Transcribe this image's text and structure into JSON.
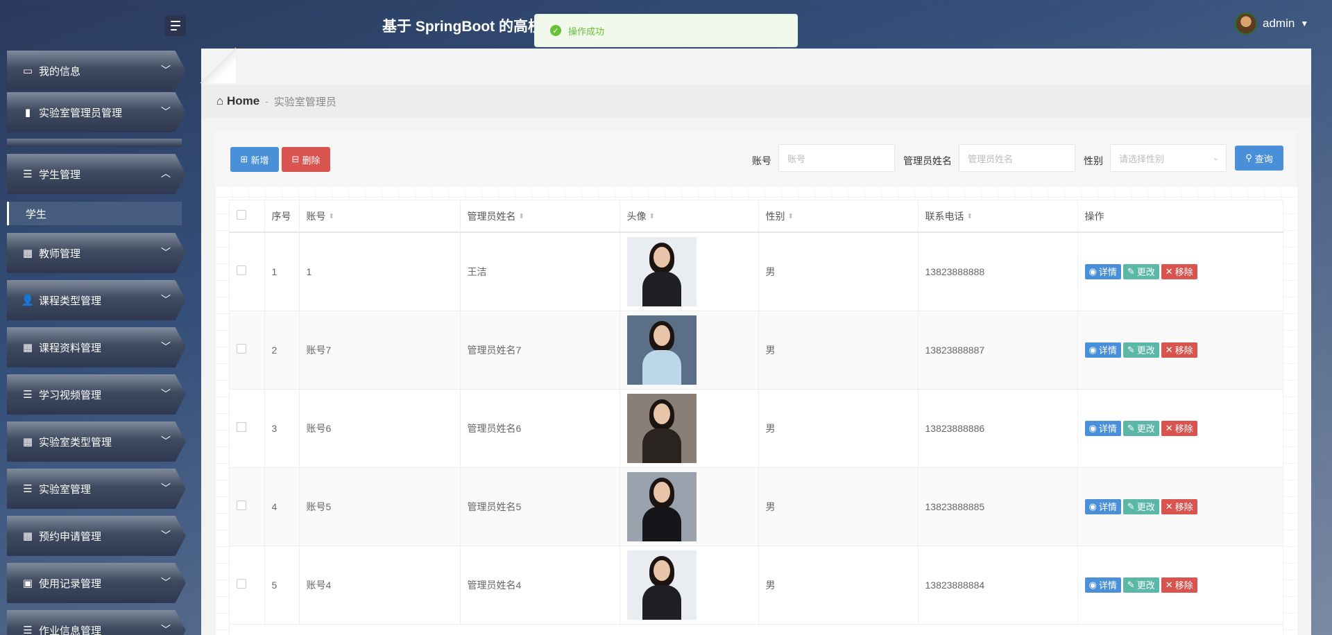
{
  "header": {
    "title": "基于 SpringBoot 的高校",
    "toast": "操作成功",
    "user": "admin"
  },
  "sidebar": {
    "items": [
      {
        "label": "我的信息",
        "icon": "id-card-icon",
        "glyph": "▭"
      },
      {
        "label": "实验室管理员管理",
        "icon": "book-icon",
        "glyph": "▮"
      },
      {
        "label": "学生管理",
        "icon": "sliders-icon",
        "glyph": "☰",
        "expanded": true
      },
      {
        "label": "教师管理",
        "icon": "grid-icon",
        "glyph": "▦"
      },
      {
        "label": "课程类型管理",
        "icon": "user-icon",
        "glyph": "👤"
      },
      {
        "label": "课程资料管理",
        "icon": "grid-icon",
        "glyph": "▦"
      },
      {
        "label": "学习视频管理",
        "icon": "list-icon",
        "glyph": "☰"
      },
      {
        "label": "实验室类型管理",
        "icon": "grid-icon",
        "glyph": "▦"
      },
      {
        "label": "实验室管理",
        "icon": "list-icon",
        "glyph": "☰"
      },
      {
        "label": "预约申请管理",
        "icon": "apps-icon",
        "glyph": "▦"
      },
      {
        "label": "使用记录管理",
        "icon": "clipboard-icon",
        "glyph": "▣"
      },
      {
        "label": "作业信息管理",
        "icon": "list-icon",
        "glyph": "☰"
      }
    ],
    "sub_item": "学生"
  },
  "breadcrumb": {
    "home": "Home",
    "separator": "-",
    "current": "实验室管理员"
  },
  "toolbar": {
    "add_label": "新增",
    "delete_label": "删除",
    "search_label": "查询",
    "filters": {
      "account_label": "账号",
      "account_placeholder": "账号",
      "name_label": "管理员姓名",
      "name_placeholder": "管理员姓名",
      "gender_label": "性别",
      "gender_placeholder": "请选择性别"
    }
  },
  "table": {
    "headers": [
      "序号",
      "账号",
      "管理员姓名",
      "头像",
      "性别",
      "联系电话",
      "操作"
    ],
    "actions": {
      "detail": "详情",
      "edit": "更改",
      "remove": "移除"
    },
    "rows": [
      {
        "index": "1",
        "account": "1",
        "name": "王洁",
        "gender": "男",
        "phone": "13823888888",
        "photo_bg": "#e9edf2",
        "outfit": "#1e1e24"
      },
      {
        "index": "2",
        "account": "账号7",
        "name": "管理员姓名7",
        "gender": "男",
        "phone": "13823888887",
        "photo_bg": "#5b6f86",
        "outfit": "#bcd6ea"
      },
      {
        "index": "3",
        "account": "账号6",
        "name": "管理员姓名6",
        "gender": "男",
        "phone": "13823888886",
        "photo_bg": "#8a7f76",
        "outfit": "#2a2420"
      },
      {
        "index": "4",
        "account": "账号5",
        "name": "管理员姓名5",
        "gender": "男",
        "phone": "13823888885",
        "photo_bg": "#9aa3ad",
        "outfit": "#15151a"
      },
      {
        "index": "5",
        "account": "账号4",
        "name": "管理员姓名4",
        "gender": "男",
        "phone": "13823888884",
        "photo_bg": "#e9edf2",
        "outfit": "#1e1e24"
      }
    ]
  }
}
